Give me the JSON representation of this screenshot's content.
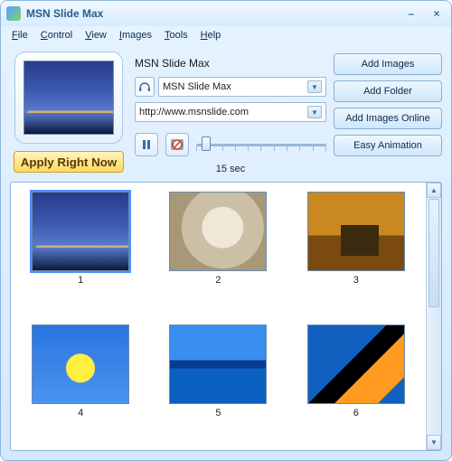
{
  "window": {
    "title": "MSN Slide Max"
  },
  "menubar": [
    "File",
    "Control",
    "View",
    "Images",
    "Tools",
    "Help"
  ],
  "preview": {
    "image_name": "golden-gate-bridge"
  },
  "apply_label": "Apply Right Now",
  "nickname": {
    "heading": "MSN Slide Max",
    "combo_value": "MSN Slide Max"
  },
  "url": {
    "value": "http://www.msnslide.com"
  },
  "playback": {
    "pause_icon": "pause-icon",
    "noimage_icon": "disable-image-icon",
    "interval_label": "15 sec"
  },
  "side_buttons": {
    "add_images": "Add Images",
    "add_folder": "Add Folder",
    "add_online": "Add Images Online",
    "easy_anim": "Easy Animation"
  },
  "gallery": [
    {
      "num": "1",
      "name": "golden-gate-bridge",
      "selected": true
    },
    {
      "num": "2",
      "name": "snail-shell",
      "selected": false
    },
    {
      "num": "3",
      "name": "park-bench-autumn",
      "selected": false
    },
    {
      "num": "4",
      "name": "dandelion-sky",
      "selected": false
    },
    {
      "num": "5",
      "name": "tropical-island",
      "selected": false
    },
    {
      "num": "6",
      "name": "toucan",
      "selected": false
    }
  ]
}
